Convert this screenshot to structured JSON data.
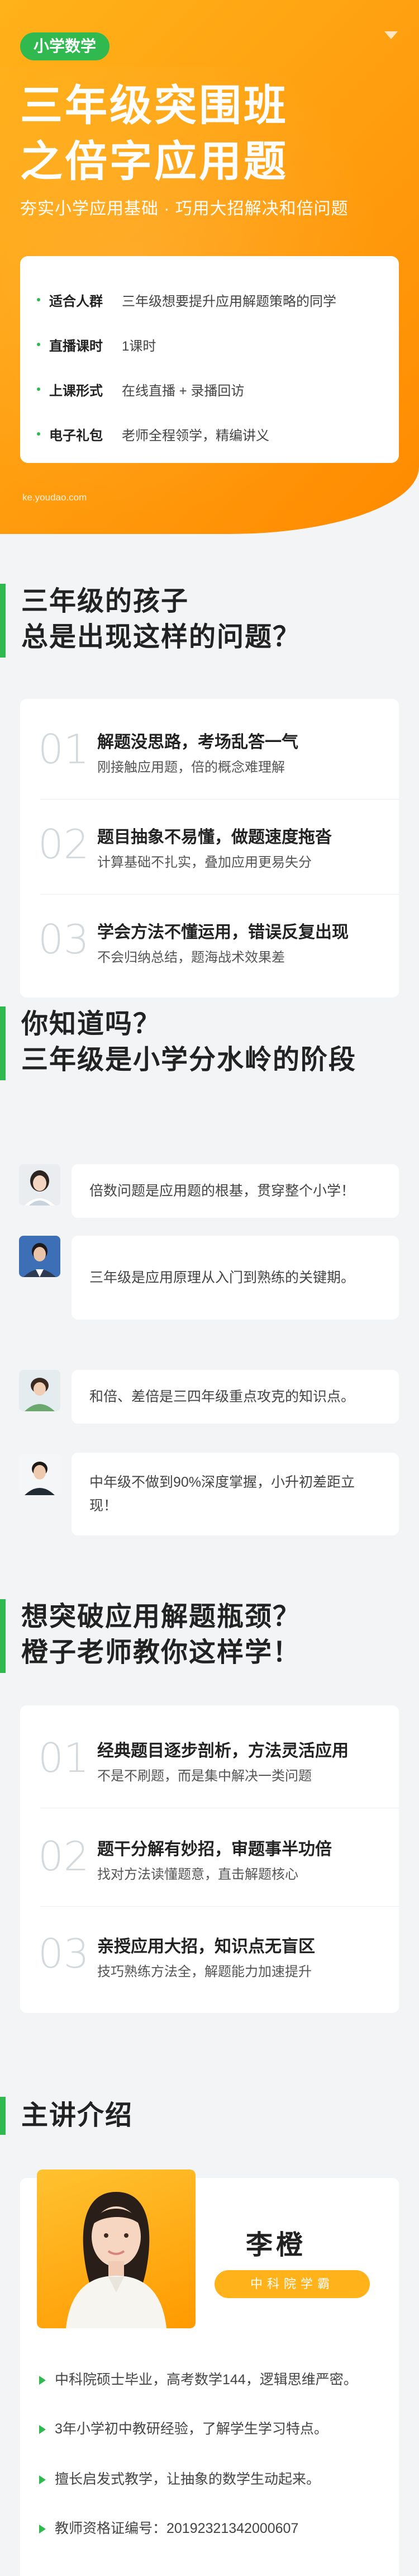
{
  "hero": {
    "tag": "小学数学",
    "title_line1": "三年级突围班",
    "title_line2": "之倍字应用题",
    "subtitle": "夯实小学应用基础 · 巧用大招解决和倍问题",
    "info": [
      {
        "key": "适合人群",
        "value": "三年级想要提升应用解题策略的同学"
      },
      {
        "key": "直播课时",
        "value": "1课时"
      },
      {
        "key": "上课形式",
        "value": "在线直播 + 录播回访"
      },
      {
        "key": "电子礼包",
        "value": "老师全程领学，精编讲义"
      }
    ],
    "domain": "ke.youdao.com"
  },
  "section1": {
    "title_line1": "三年级的孩子",
    "title_line2": "总是出现这样的问题？",
    "items": [
      {
        "num": "01",
        "title": "解题没思路，考场乱答一气",
        "desc": "刚接触应用题，倍的概念难理解"
      },
      {
        "num": "02",
        "title": "题目抽象不易懂，做题速度拖沓",
        "desc": "计算基础不扎实，叠加应用更易失分"
      },
      {
        "num": "03",
        "title": "学会方法不懂运用，错误反复出现",
        "desc": "不会归纳总结，题海战术效果差"
      }
    ]
  },
  "section2": {
    "title_line1": "你知道吗？",
    "title_line2": "三年级是小学分水岭的阶段",
    "facts": [
      "倍数问题是应用题的根基，贯穿整个小学！",
      "三年级是应用原理从入门到熟练的关键期。",
      "和倍、差倍是三四年级重点攻克的知识点。",
      "中年级不做到90%深度掌握，小升初差距立现！"
    ]
  },
  "section3": {
    "title_line1": "想突破应用解题瓶颈？",
    "title_line2": "橙子老师教你这样学！",
    "items": [
      {
        "num": "01",
        "title": "经典题目逐步剖析，方法灵活应用",
        "desc": "不是不刷题，而是集中解决一类问题"
      },
      {
        "num": "02",
        "title": "题干分解有妙招，审题事半功倍",
        "desc": "找对方法读懂题意，直击解题核心"
      },
      {
        "num": "03",
        "title": "亲授应用大招，知识点无盲区",
        "desc": "技巧熟练方法全，解题能力加速提升"
      }
    ]
  },
  "teacher": {
    "section_title": "主讲介绍",
    "name": "李橙",
    "badge": "中科院学霸",
    "points": [
      "中科院硕士毕业，高考数学144，逻辑思维严密。",
      "3年小学初中教研经验，了解学生学习特点。",
      "擅长启发式教学，让抽象的数学生动起来。",
      "教师资格证编号：20192321342000607"
    ]
  },
  "colors": {
    "accent_green": "#2fb94e",
    "hero_orange": "#ffa010",
    "badge_orange": "#ffb21a"
  }
}
